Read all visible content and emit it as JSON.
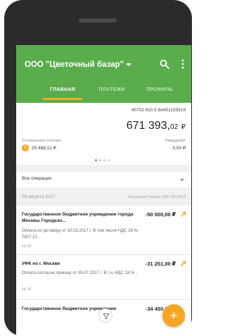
{
  "header": {
    "title": "ООО \"Цветочный базар\"",
    "tabs": [
      {
        "label": "ГЛАВНАЯ",
        "active": true
      },
      {
        "label": "ПЛАТЕЖИ",
        "active": false
      },
      {
        "label": "ПРОФИЛЬ",
        "active": false
      }
    ],
    "icons": [
      "search-icon",
      "more-vertical-icon",
      "chevron-down-icon"
    ]
  },
  "account": {
    "number": "40702 810 5 84451155519",
    "balance_main": "671 393,",
    "balance_kopecks": "02",
    "currency": "₽",
    "pending_label": "Отложенные платежи",
    "pending_count": "1",
    "pending_amount": "25 488,12 ₽",
    "overdraft_label": "Овердрафт",
    "overdraft_amount": "0,00 ₽",
    "carousel_pages": 4,
    "carousel_active": 0
  },
  "filter": {
    "selected": "Все операции"
  },
  "date_header": {
    "date": "29 августа 2017",
    "incoming_balance": "Входящий баланс: 999 450,00 ₽"
  },
  "operations": [
    {
      "name": "Государственное бюджетное учреждение города Москвы Городско...",
      "amount": "-50 000,00 ₽",
      "description": "Оплата по договору от 10.03.2017 г. В том числе НДС 18 % - 7627.12",
      "code": "№ 53"
    },
    {
      "name": "УФК по г. Москве",
      "amount": "-31 251,00 ₽",
      "description": "Оплата согласно приказу от 05.07.2017 г. В т.ч. НДС 18 % -",
      "code": "№ 16"
    },
    {
      "name": "Государственное бюджетное учреждение",
      "amount": "-34 450,00 ₽",
      "description": "",
      "code": ""
    }
  ],
  "colors": {
    "primary": "#5aac4d",
    "accent": "#f6a623",
    "device": "#2b2b2b"
  },
  "fab": {
    "add_label": "+"
  }
}
